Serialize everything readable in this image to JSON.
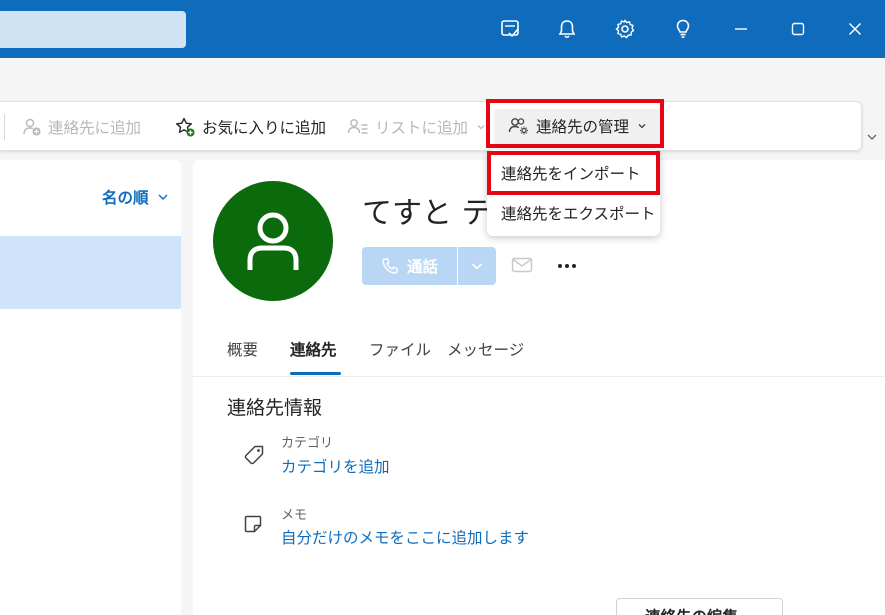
{
  "titlebar": {
    "icons": [
      "todo-icon",
      "bell-icon",
      "gear-icon",
      "lightbulb-icon",
      "minimize-icon",
      "maximize-icon",
      "close-icon"
    ],
    "accent": "#0f6cbd"
  },
  "ribbon": {
    "add_contact": "連絡先に追加",
    "add_favorite": "お気に入りに追加",
    "add_to_list": "リストに追加",
    "manage_contacts": "連絡先の管理"
  },
  "menu": {
    "import": "連絡先をインポート",
    "export": "連絡先をエクスポート"
  },
  "list": {
    "sort_label": "名の順"
  },
  "contact": {
    "name": "てすと テスト",
    "call_label": "通話",
    "avatar_color": "#0b6a0b"
  },
  "tabs": [
    {
      "label": "概要",
      "active": false
    },
    {
      "label": "連絡先",
      "active": true
    },
    {
      "label": "ファイル",
      "active": false
    },
    {
      "label": "メッセージ",
      "active": false
    }
  ],
  "info": {
    "section_title": "連絡先情報",
    "category_label": "カテゴリ",
    "category_link": "カテゴリを追加",
    "memo_label": "メモ",
    "memo_link": "自分だけのメモをここに追加します",
    "edit_button": "連絡先の編集"
  },
  "highlight_color": "#e30613"
}
